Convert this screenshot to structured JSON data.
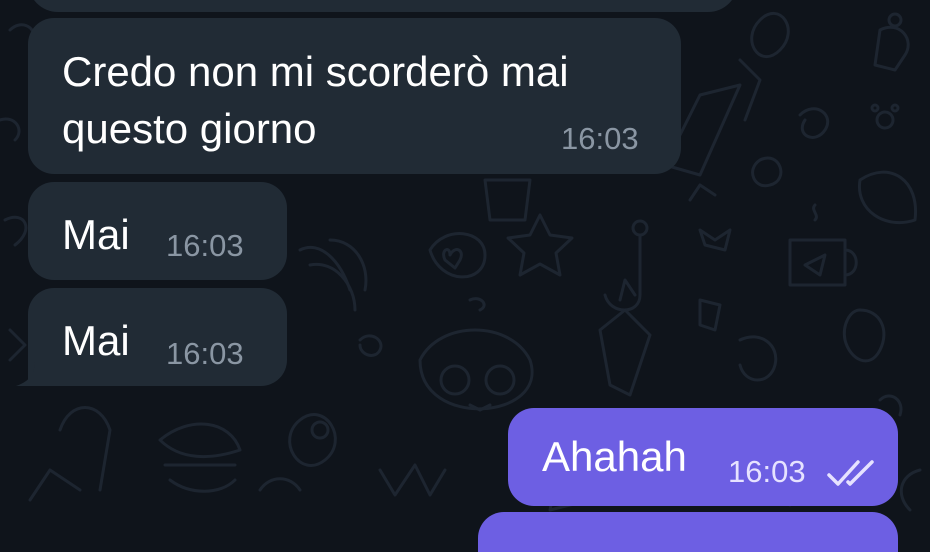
{
  "chat": {
    "messages": [
      {
        "direction": "incoming",
        "lines": [
          "Credo non mi scorderò mai",
          "questo giorno"
        ],
        "time": "16:03"
      },
      {
        "direction": "incoming",
        "lines": [
          "Mai"
        ],
        "time": "16:03"
      },
      {
        "direction": "incoming",
        "lines": [
          "Mai"
        ],
        "time": "16:03"
      },
      {
        "direction": "outgoing",
        "lines": [
          "Ahahah"
        ],
        "time": "16:03",
        "status_icon": "double-check-icon"
      }
    ]
  },
  "colors": {
    "background": "#0f141b",
    "incoming_bubble": "#212b35",
    "outgoing_bubble": "#6d5fe3",
    "incoming_time": "#8a96a3"
  }
}
